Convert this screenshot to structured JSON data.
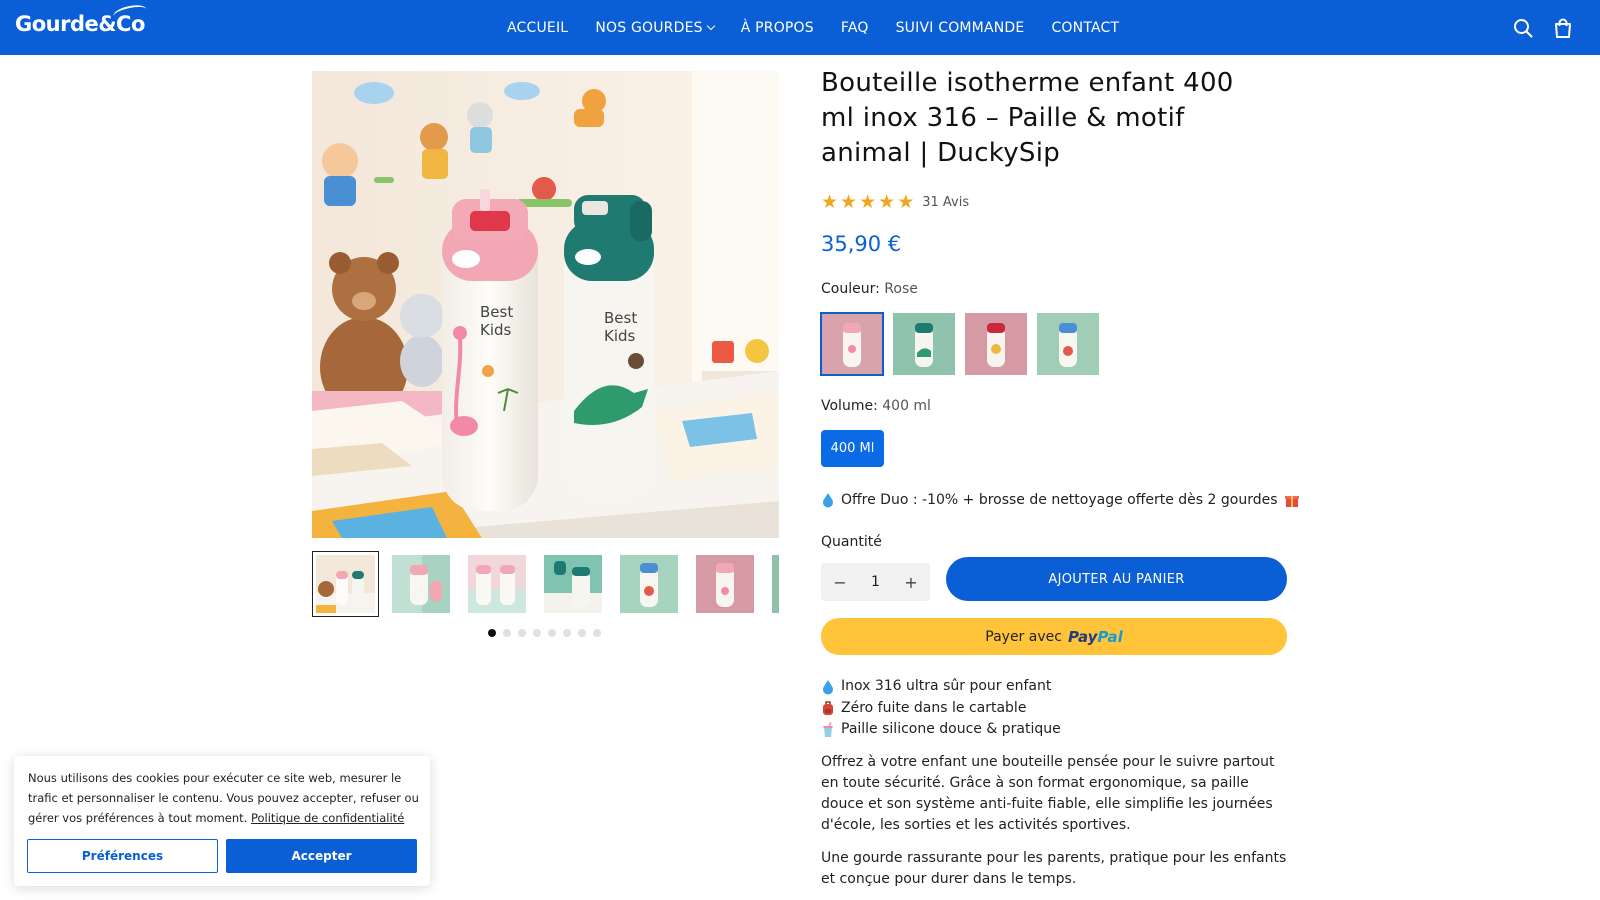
{
  "header": {
    "logo": "Gourde&Co",
    "nav": [
      {
        "label": "ACCUEIL"
      },
      {
        "label": "NOS GOURDES",
        "has_dropdown": true
      },
      {
        "label": "À PROPOS"
      },
      {
        "label": "FAQ"
      },
      {
        "label": "SUIVI COMMANDE"
      },
      {
        "label": "CONTACT"
      }
    ],
    "icons": [
      "search-icon",
      "shopping-bag-icon"
    ],
    "background_color": "#0b5fd6"
  },
  "gallery": {
    "main_image_text": {
      "bottle_1": "Best Kids",
      "bottle_2": "Best Kids"
    },
    "thumbnail_count": 7,
    "active_thumbnail": 1,
    "dot_count": 8,
    "active_dot": 1
  },
  "product": {
    "title": "Bouteille isotherme enfant 400 ml inox 316 – Paille & motif animal | DuckySip",
    "rating": 5,
    "reviews": "31 Avis",
    "price": "35,90 €",
    "color_label": "Couleur:",
    "color_value": "Rose",
    "swatch_count": 4,
    "volume_label": "Volume:",
    "volume_value": "400 ml",
    "volume_button": "400 Ml",
    "offer": "Offre Duo : -10% + brosse de nettoyage offerte dès 2 gourdes",
    "quantity_label": "Quantité",
    "quantity_value": "1",
    "minus": "−",
    "plus": "+",
    "add_to_cart": "AJOUTER AU PANIER",
    "paypal_prefix": "Payer avec",
    "paypal_brand_1": "Pay",
    "paypal_brand_2": "Pal",
    "features": [
      {
        "icon": "droplet-icon",
        "text": "Inox 316 ultra sûr pour enfant"
      },
      {
        "icon": "backpack-icon",
        "text": "Zéro fuite dans le cartable"
      },
      {
        "icon": "cup-straw-icon",
        "text": "Paille silicone douce & pratique"
      }
    ],
    "description_1": "Offrez à votre enfant une bouteille pensée pour le suivre partout en toute sécurité. Grâce à son format ergonomique, sa paille douce et son système anti-fuite fiable, elle simplifie les journées d'école, les sorties et les activités sportives.",
    "description_2": "Une gourde rassurante pour les parents, pratique pour les enfants et conçue pour durer dans le temps.",
    "accent_color": "#0b5fd6",
    "star_color": "#f2a51f",
    "paypal_color": "#ffc439"
  },
  "cookie_banner": {
    "text": "Nous utilisons des cookies pour exécuter ce site web, mesurer le trafic et personnaliser le contenu. Vous pouvez accepter, refuser ou gérer vos préférences à tout moment.",
    "link": "Politique de confidentialité",
    "preferences_button": "Préférences",
    "accept_button": "Accepter"
  }
}
